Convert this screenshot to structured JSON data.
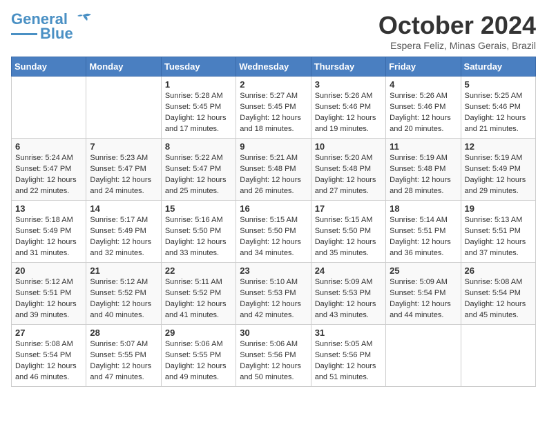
{
  "header": {
    "logo_line1": "General",
    "logo_line2": "Blue",
    "month": "October 2024",
    "location": "Espera Feliz, Minas Gerais, Brazil"
  },
  "days_of_week": [
    "Sunday",
    "Monday",
    "Tuesday",
    "Wednesday",
    "Thursday",
    "Friday",
    "Saturday"
  ],
  "weeks": [
    [
      {
        "day": "",
        "info": ""
      },
      {
        "day": "",
        "info": ""
      },
      {
        "day": "1",
        "info": "Sunrise: 5:28 AM\nSunset: 5:45 PM\nDaylight: 12 hours and 17 minutes."
      },
      {
        "day": "2",
        "info": "Sunrise: 5:27 AM\nSunset: 5:45 PM\nDaylight: 12 hours and 18 minutes."
      },
      {
        "day": "3",
        "info": "Sunrise: 5:26 AM\nSunset: 5:46 PM\nDaylight: 12 hours and 19 minutes."
      },
      {
        "day": "4",
        "info": "Sunrise: 5:26 AM\nSunset: 5:46 PM\nDaylight: 12 hours and 20 minutes."
      },
      {
        "day": "5",
        "info": "Sunrise: 5:25 AM\nSunset: 5:46 PM\nDaylight: 12 hours and 21 minutes."
      }
    ],
    [
      {
        "day": "6",
        "info": "Sunrise: 5:24 AM\nSunset: 5:47 PM\nDaylight: 12 hours and 22 minutes."
      },
      {
        "day": "7",
        "info": "Sunrise: 5:23 AM\nSunset: 5:47 PM\nDaylight: 12 hours and 24 minutes."
      },
      {
        "day": "8",
        "info": "Sunrise: 5:22 AM\nSunset: 5:47 PM\nDaylight: 12 hours and 25 minutes."
      },
      {
        "day": "9",
        "info": "Sunrise: 5:21 AM\nSunset: 5:48 PM\nDaylight: 12 hours and 26 minutes."
      },
      {
        "day": "10",
        "info": "Sunrise: 5:20 AM\nSunset: 5:48 PM\nDaylight: 12 hours and 27 minutes."
      },
      {
        "day": "11",
        "info": "Sunrise: 5:19 AM\nSunset: 5:48 PM\nDaylight: 12 hours and 28 minutes."
      },
      {
        "day": "12",
        "info": "Sunrise: 5:19 AM\nSunset: 5:49 PM\nDaylight: 12 hours and 29 minutes."
      }
    ],
    [
      {
        "day": "13",
        "info": "Sunrise: 5:18 AM\nSunset: 5:49 PM\nDaylight: 12 hours and 31 minutes."
      },
      {
        "day": "14",
        "info": "Sunrise: 5:17 AM\nSunset: 5:49 PM\nDaylight: 12 hours and 32 minutes."
      },
      {
        "day": "15",
        "info": "Sunrise: 5:16 AM\nSunset: 5:50 PM\nDaylight: 12 hours and 33 minutes."
      },
      {
        "day": "16",
        "info": "Sunrise: 5:15 AM\nSunset: 5:50 PM\nDaylight: 12 hours and 34 minutes."
      },
      {
        "day": "17",
        "info": "Sunrise: 5:15 AM\nSunset: 5:50 PM\nDaylight: 12 hours and 35 minutes."
      },
      {
        "day": "18",
        "info": "Sunrise: 5:14 AM\nSunset: 5:51 PM\nDaylight: 12 hours and 36 minutes."
      },
      {
        "day": "19",
        "info": "Sunrise: 5:13 AM\nSunset: 5:51 PM\nDaylight: 12 hours and 37 minutes."
      }
    ],
    [
      {
        "day": "20",
        "info": "Sunrise: 5:12 AM\nSunset: 5:51 PM\nDaylight: 12 hours and 39 minutes."
      },
      {
        "day": "21",
        "info": "Sunrise: 5:12 AM\nSunset: 5:52 PM\nDaylight: 12 hours and 40 minutes."
      },
      {
        "day": "22",
        "info": "Sunrise: 5:11 AM\nSunset: 5:52 PM\nDaylight: 12 hours and 41 minutes."
      },
      {
        "day": "23",
        "info": "Sunrise: 5:10 AM\nSunset: 5:53 PM\nDaylight: 12 hours and 42 minutes."
      },
      {
        "day": "24",
        "info": "Sunrise: 5:09 AM\nSunset: 5:53 PM\nDaylight: 12 hours and 43 minutes."
      },
      {
        "day": "25",
        "info": "Sunrise: 5:09 AM\nSunset: 5:54 PM\nDaylight: 12 hours and 44 minutes."
      },
      {
        "day": "26",
        "info": "Sunrise: 5:08 AM\nSunset: 5:54 PM\nDaylight: 12 hours and 45 minutes."
      }
    ],
    [
      {
        "day": "27",
        "info": "Sunrise: 5:08 AM\nSunset: 5:54 PM\nDaylight: 12 hours and 46 minutes."
      },
      {
        "day": "28",
        "info": "Sunrise: 5:07 AM\nSunset: 5:55 PM\nDaylight: 12 hours and 47 minutes."
      },
      {
        "day": "29",
        "info": "Sunrise: 5:06 AM\nSunset: 5:55 PM\nDaylight: 12 hours and 49 minutes."
      },
      {
        "day": "30",
        "info": "Sunrise: 5:06 AM\nSunset: 5:56 PM\nDaylight: 12 hours and 50 minutes."
      },
      {
        "day": "31",
        "info": "Sunrise: 5:05 AM\nSunset: 5:56 PM\nDaylight: 12 hours and 51 minutes."
      },
      {
        "day": "",
        "info": ""
      },
      {
        "day": "",
        "info": ""
      }
    ]
  ]
}
